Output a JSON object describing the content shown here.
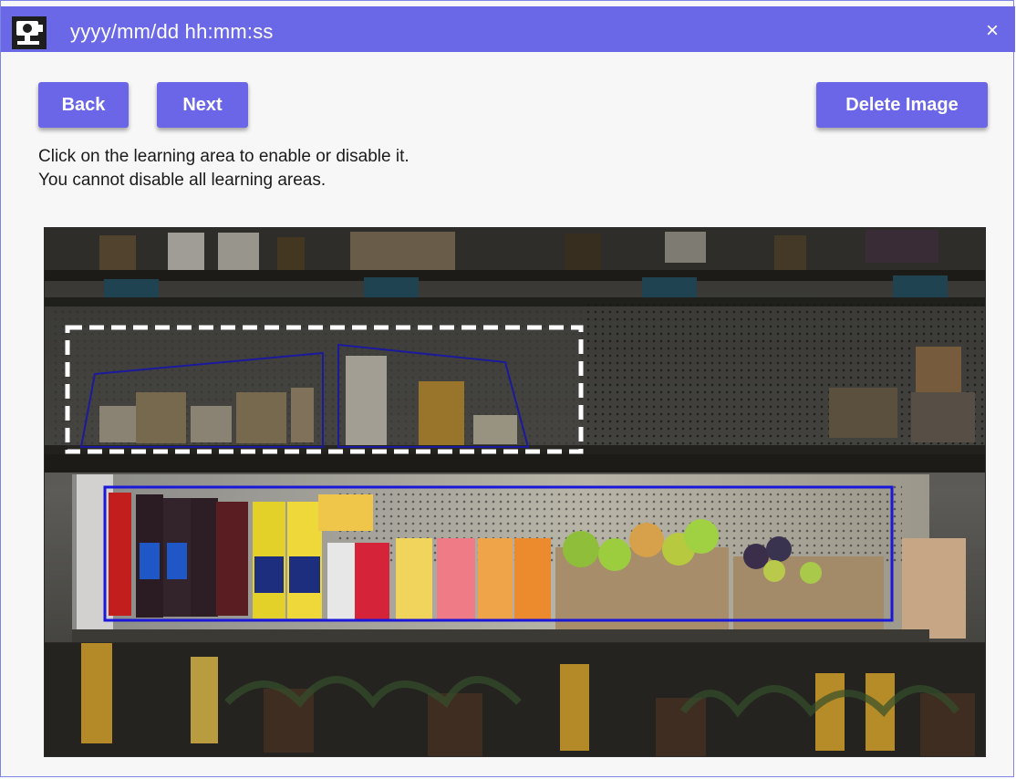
{
  "window": {
    "title": "yyyy/mm/dd hh:mm:ss",
    "close_glyph": "×",
    "app_icon": "camera-app-icon",
    "title_bar_color": "#6a68e6"
  },
  "toolbar": {
    "back_label": "Back",
    "next_label": "Next",
    "delete_label": "Delete Image",
    "button_color": "#6b66e8"
  },
  "instructions": {
    "line1": "Click on the learning area to enable or disable it.",
    "line2": "You cannot disable all learning areas."
  },
  "image": {
    "subject": "refrigerated store display shelf with packaged food, bottled drinks and fruit crates",
    "learning_areas": [
      {
        "id": "upper-shelf",
        "state": "disabled",
        "outline": "white-dashed"
      },
      {
        "id": "middle-shelf",
        "state": "enabled",
        "outline": "blue"
      }
    ],
    "enabled_area_color": "#1a17d8",
    "disabled_area_color": "#ffffff"
  }
}
